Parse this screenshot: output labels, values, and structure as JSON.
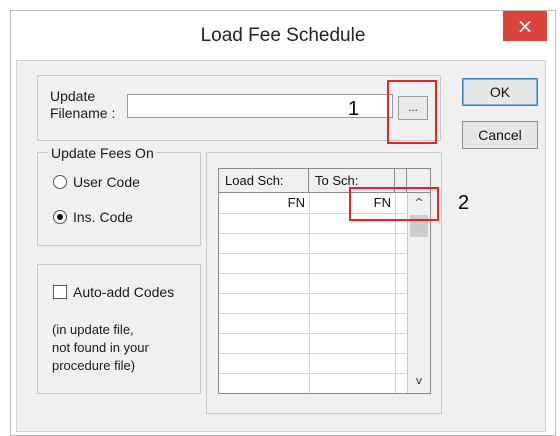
{
  "window": {
    "title": "Load Fee Schedule",
    "close_glyph": "×"
  },
  "update_file": {
    "label_line1": "Update",
    "label_line2": "Filename :",
    "value": "",
    "browse_label": "..."
  },
  "buttons": {
    "ok": "OK",
    "cancel": "Cancel"
  },
  "update_fees_on": {
    "legend": "Update Fees On",
    "options": [
      {
        "label": "User Code",
        "selected": false
      },
      {
        "label": "Ins. Code",
        "selected": true
      }
    ]
  },
  "auto_add": {
    "label": "Auto-add Codes",
    "checked": false,
    "note_line1": "(in update file,",
    "note_line2": "not found in your",
    "note_line3": "procedure file)"
  },
  "grid": {
    "columns": [
      "Load Sch:",
      "To Sch:"
    ],
    "rows": [
      {
        "load": "FN",
        "to": "FN"
      }
    ],
    "scroll_up": "^",
    "scroll_down": "v"
  },
  "annotations": [
    {
      "number": "1"
    },
    {
      "number": "2"
    }
  ],
  "colors": {
    "annotation": "#e5252a",
    "close_button": "#d9443c"
  }
}
